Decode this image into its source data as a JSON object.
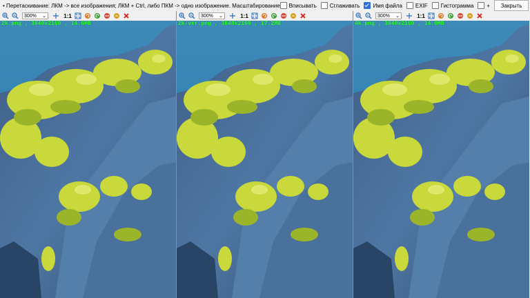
{
  "hint": "• Перетаскивание: ЛКМ -> все изображения; ЛКМ + Ctrl, либо ПКМ -> одно изображение. Масштабирование: колёсико мыши.",
  "options": [
    {
      "label": "Вписывать",
      "checked": false
    },
    {
      "label": "Сглаживать",
      "checked": false
    },
    {
      "label": "Имя файла",
      "checked": true
    },
    {
      "label": "EXIF",
      "checked": false
    },
    {
      "label": "Гистограмма",
      "checked": false
    },
    {
      "label": "+",
      "checked": false
    }
  ],
  "close_label": "Закрыть",
  "panels": [
    {
      "zoom": "300%",
      "one_to_one": "1:1",
      "caption": "2k.png , 3840x2160 , 14.6MB"
    },
    {
      "zoom": "300%",
      "one_to_one": "1:1",
      "caption": "2k-ver.png , 3840x2160 , 17.2MB"
    },
    {
      "zoom": "300%",
      "one_to_one": "1:1",
      "caption": "4k.png , 3840x2160 , 14.0MB"
    }
  ],
  "icons": [
    "zoom-in-icon",
    "zoom-out-icon",
    "fit-icon",
    "rotate-left-icon",
    "rotate-right-icon",
    "flip-icon",
    "swap-icon",
    "delete-icon"
  ]
}
